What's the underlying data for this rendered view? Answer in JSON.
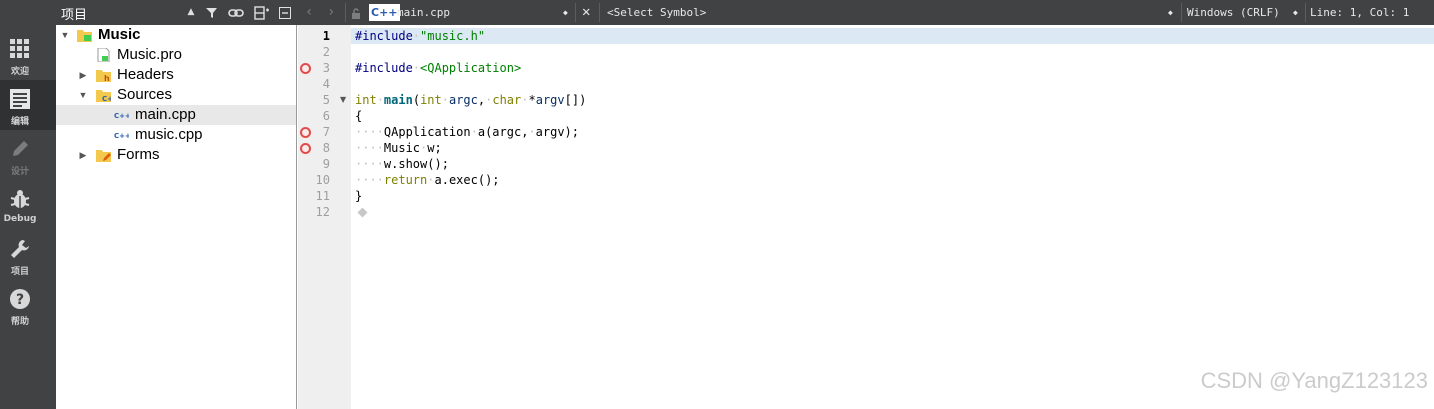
{
  "modebar": {
    "modes": [
      {
        "label": "欢迎",
        "icon": "welcome-grid-icon"
      },
      {
        "label": "编辑",
        "icon": "edit-document-icon"
      },
      {
        "label": "设计",
        "icon": "design-pencil-icon"
      },
      {
        "label": "Debug",
        "icon": "debug-bug-icon"
      },
      {
        "label": "项目",
        "icon": "project-wrench-icon"
      },
      {
        "label": "帮助",
        "icon": "help-question-icon"
      }
    ]
  },
  "project_panel": {
    "title": "项目",
    "tree": [
      {
        "label": "Music",
        "icon": "qt-project-folder-icon"
      },
      {
        "label": "Music.pro",
        "icon": "pro-file-icon"
      },
      {
        "label": "Headers",
        "icon": "headers-folder-icon"
      },
      {
        "label": "Sources",
        "icon": "sources-folder-icon"
      },
      {
        "label": "main.cpp",
        "icon": "cpp-file-icon"
      },
      {
        "label": "music.cpp",
        "icon": "cpp-file-icon"
      },
      {
        "label": "Forms",
        "icon": "forms-folder-icon"
      }
    ]
  },
  "editor_toolbar": {
    "lang_badge": "C++",
    "file": "main.cpp",
    "symbol": "<Select Symbol>",
    "line_ending": "Windows (CRLF)",
    "position": "Line: 1, Col: 1"
  },
  "code": {
    "line_numbers": [
      "1",
      "2",
      "3",
      "4",
      "5",
      "6",
      "7",
      "8",
      "9",
      "10",
      "11",
      "12"
    ],
    "current_line": 1,
    "lines": [
      "#include \"music.h\"",
      "",
      "#include <QApplication>",
      "",
      "int main(int argc, char *argv[])",
      "{",
      "    QApplication a(argc, argv);",
      "    Music w;",
      "    w.show();",
      "    return a.exec();",
      "}",
      ""
    ]
  },
  "watermark": "CSDN @YangZ123123"
}
